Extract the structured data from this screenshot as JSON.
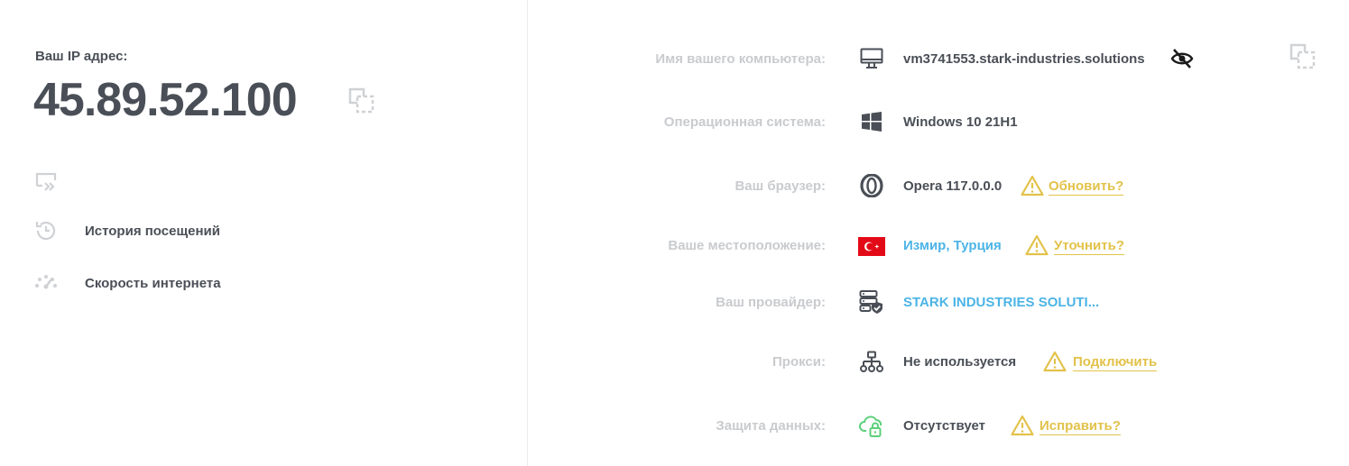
{
  "left": {
    "ip_label": "Ваш IP адрес:",
    "ip_value": "45.89.52.100",
    "links": [
      {
        "label": "История посещений",
        "icon": "history-icon"
      },
      {
        "label": "Скорость интернета",
        "icon": "speedometer-icon"
      }
    ]
  },
  "right": {
    "rows": [
      {
        "label": "Имя вашего компьютера:",
        "value": "vm3741553.stark-industries.solutions",
        "icon": "monitor-icon"
      },
      {
        "label": "Операционная система:",
        "value": "Windows 10 21H1",
        "icon": "windows-icon"
      },
      {
        "label": "Ваш браузер:",
        "value": "Opera 117.0.0.0",
        "icon": "opera-icon",
        "action": "Обновить?"
      },
      {
        "label": "Ваше местоположение:",
        "value": "Измир, Турция",
        "icon": "turkey-flag-icon",
        "action": "Уточнить?"
      },
      {
        "label": "Ваш провайдер:",
        "value": "STARK INDUSTRIES SOLUTI...",
        "icon": "server-shield-icon"
      },
      {
        "label": "Прокси:",
        "value": "Не используется",
        "icon": "network-icon",
        "action": "Подключить"
      },
      {
        "label": "Защита данных:",
        "value": "Отсутствует",
        "icon": "cloud-lock-icon",
        "action": "Исправить?"
      }
    ]
  },
  "colors": {
    "text": "#4a4f57",
    "label": "#c9cbce",
    "link": "#4cb4e6",
    "warning": "#e2c24a",
    "icon_light": "#cfd1d4",
    "green": "#5cd07a",
    "flag_red": "#e30a17"
  }
}
